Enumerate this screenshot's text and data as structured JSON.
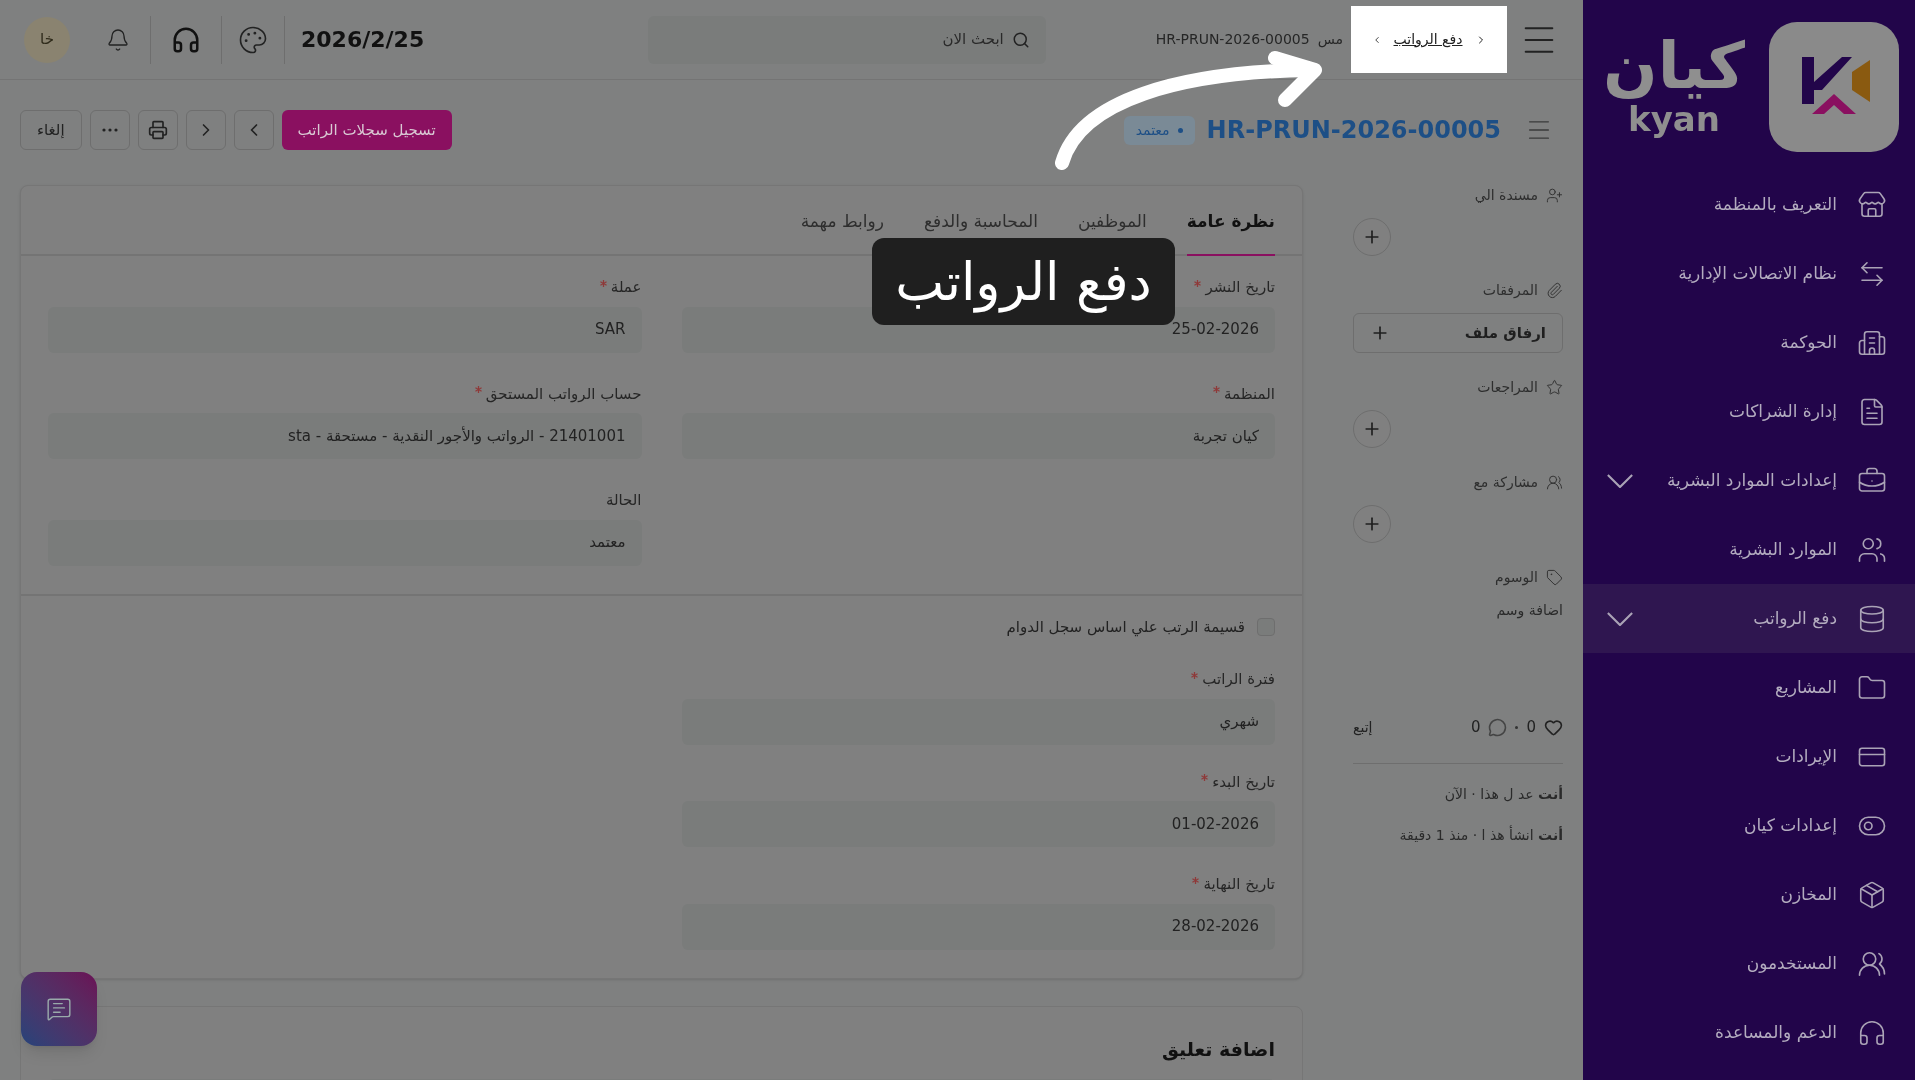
{
  "sidebar": {
    "logo": {
      "arabic": "كيان",
      "latin": "kyan"
    },
    "items": [
      {
        "label": "التعريف بالمنظمة",
        "selected": false,
        "expandable": false
      },
      {
        "label": "نظام الاتصالات الإدارية",
        "selected": false,
        "expandable": false
      },
      {
        "label": "الحوكمة",
        "selected": false,
        "expandable": false
      },
      {
        "label": "إدارة الشراكات",
        "selected": false,
        "expandable": false
      },
      {
        "label": "إعدادات الموارد البشرية",
        "selected": false,
        "expandable": true
      },
      {
        "label": "الموارد البشرية",
        "selected": false,
        "expandable": false
      },
      {
        "label": "دفع الرواتب",
        "selected": true,
        "expandable": true
      },
      {
        "label": "المشاريع",
        "selected": false,
        "expandable": false
      },
      {
        "label": "الإيرادات",
        "selected": false,
        "expandable": false
      },
      {
        "label": "إعدادات كيان",
        "selected": false,
        "expandable": false
      },
      {
        "label": "المخازن",
        "selected": false,
        "expandable": false
      },
      {
        "label": "المستخدمون",
        "selected": false,
        "expandable": false
      },
      {
        "label": "الدعم والمساعدة",
        "selected": false,
        "expandable": false
      }
    ]
  },
  "top_bar": {
    "breadcrumbs": [
      {
        "label": "دفع الرواتب",
        "highlighted": true
      },
      {
        "label": "مس",
        "highlighted": false
      },
      {
        "label": "HR-PRUN-2026-00005",
        "highlighted": false
      }
    ],
    "search": {
      "placeholder": "ابحث الان"
    },
    "date": "2026/2/25",
    "avatar": "خا"
  },
  "header": {
    "title": "HR-PRUN-2026-00005",
    "status": "معتمد",
    "primary_button": "تسجيل سجلات الراتب",
    "cancel_button": "إلغاء"
  },
  "tabs": [
    {
      "label": "نظرة عامة",
      "selected": true
    },
    {
      "label": "الموظفين",
      "selected": false
    },
    {
      "label": "المحاسبة والدفع",
      "selected": false
    },
    {
      "label": "روابط مهمة",
      "selected": false
    }
  ],
  "section_1": {
    "right": [
      {
        "label": "تاريخ النشر",
        "required": true,
        "value": "25-02-2026"
      },
      {
        "label": "المنظمة",
        "required": true,
        "value": "كيان تجربة"
      }
    ],
    "left": [
      {
        "label": "عملة",
        "required": true,
        "value": "SAR"
      },
      {
        "label": "حساب الرواتب المستحق",
        "required": true,
        "value": "21401001 - الرواتب والأجور النقدية - مستحقة - sta"
      },
      {
        "label": "الحالة",
        "required": false,
        "value": "معتمد"
      }
    ]
  },
  "section_2": {
    "checkbox": {
      "label": "قسيمة الرتب علي اساس سجل الدوام",
      "checked": false
    },
    "fields": [
      {
        "label": "فترة الراتب",
        "required": true,
        "value": "شهري"
      },
      {
        "label": "تاريخ البدء",
        "required": true,
        "value": "01-02-2026"
      },
      {
        "label": "تاريخ النهاية",
        "required": true,
        "value": "28-02-2026"
      }
    ]
  },
  "comment": {
    "title": "اضافة تعليق"
  },
  "side_panel": {
    "assigned_to": "مسندة الي",
    "attachments": "المرفقات",
    "attach_button": "ارفاق ملف",
    "reviews": "المراجعات",
    "shared_with": "مشاركة مع",
    "tags": "الوسوم",
    "add_tag": "اضافة وسم",
    "likes": "0",
    "comments": "0",
    "follow": "إتبع",
    "activity": [
      "**أنت** عد ل هذا · الآن",
      "**أنت** انشأ هذ ا · منذ 1 دقيقة"
    ]
  },
  "tour": {
    "tooltip": "دفع الرواتب"
  }
}
